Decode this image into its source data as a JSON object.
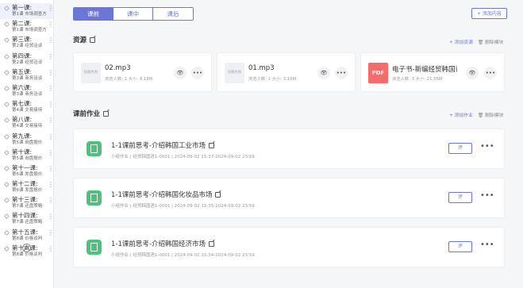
{
  "sidebar": {
    "lessons": [
      {
        "title": "第一课:",
        "subtitle": "第1课 市场调查方法"
      },
      {
        "title": "第二课:",
        "subtitle": "第1课 市场调查方法"
      },
      {
        "title": "第三课:",
        "subtitle": "第2课 经贸洽谈"
      },
      {
        "title": "第四课:",
        "subtitle": "第2课 经贸洽谈"
      },
      {
        "title": "第五课:",
        "subtitle": "第3课 商务洽谈"
      },
      {
        "title": "第六课:",
        "subtitle": "第3课 商务洽谈"
      },
      {
        "title": "第七课:",
        "subtitle": "第4课 交易接待"
      },
      {
        "title": "第八课:",
        "subtitle": "第4课 交易接待"
      },
      {
        "title": "第九课:",
        "subtitle": "第5课 询盘报价"
      },
      {
        "title": "第十课:",
        "subtitle": "第5课 询盘报价"
      },
      {
        "title": "第十一课:",
        "subtitle": "第6课 发盘报价"
      },
      {
        "title": "第十二课:",
        "subtitle": "第6课 发盘报价"
      },
      {
        "title": "第十三课:",
        "subtitle": "第7课 还盘策略"
      },
      {
        "title": "第十四课:",
        "subtitle": "第7课 还盘策略"
      },
      {
        "title": "第十五课:",
        "subtitle": "第8课 价格谈判"
      },
      {
        "title": "第十六课:",
        "subtitle": "第8课 价格谈判"
      }
    ],
    "add_icon": "⊕"
  },
  "tabs": [
    {
      "label": "课前"
    },
    {
      "label": "课中"
    },
    {
      "label": "课后"
    }
  ],
  "add_content_label": "+ 添加内容",
  "resources": {
    "title": "资源",
    "add_label": "+ 添加资源",
    "delete_label": "删除模块",
    "items": [
      {
        "thumb": "加载失败",
        "name": "02.mp3",
        "meta": "浏览人数: 1  大小: 4.18M"
      },
      {
        "thumb": "加载失败",
        "name": "01.mp3",
        "meta": "浏览人数: 1  大小: 3.16M"
      },
      {
        "thumb": "PDF",
        "name": "电子书-新编经贸韩国语",
        "meta": "浏览人数: 3  大小: 21.56M"
      }
    ]
  },
  "homework": {
    "title": "课前作业",
    "add_label": "+ 添加作业",
    "delete_label": "删除模块",
    "review_label": "评",
    "items": [
      {
        "title": "1-1课前思考-介绍韩国工业市场",
        "meta": "小组作业 | 经贸韩国语1-0001 | 2024-09-02 15:37-2024-09-02 23:59"
      },
      {
        "title": "1-1课前思考-介绍韩国化妆品市场",
        "meta": "小组作业 | 经贸韩国语1-0001 | 2024-09-02 15:35-2024-09-02 23:59"
      },
      {
        "title": "1-1课前思考-介绍韩国经济市场",
        "meta": "小组作业 | 经贸韩国语1-0001 | 2024-09-02 15:34-2024-09-02 23:59"
      }
    ]
  },
  "colors": {
    "accent": "#6b76d6",
    "homework_icon": "#4cc37c",
    "pdf": "#f56c6c"
  }
}
